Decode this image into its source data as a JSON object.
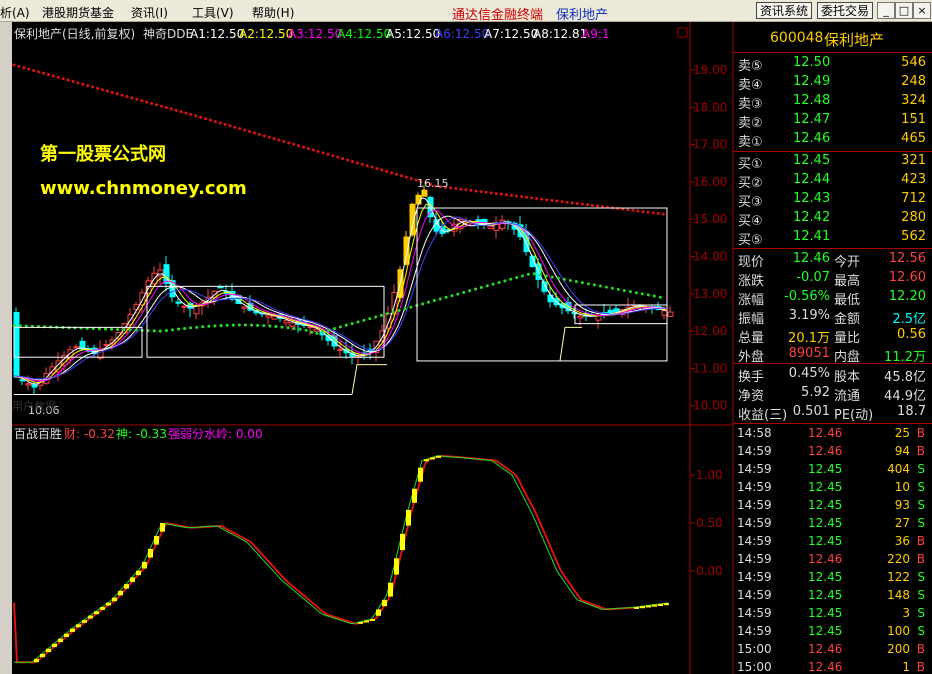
{
  "menubar": {
    "items": [
      "析(A)",
      "港股期货基金",
      "资讯(I)",
      "工具(V)",
      "帮助(H)"
    ],
    "center_title": "通达信金融终端",
    "stock_title": "保利地产",
    "buttons": [
      "资讯系统",
      "委托交易"
    ],
    "window_controls": [
      "_",
      "□",
      "×"
    ]
  },
  "chart_header": {
    "name": "保利地产(日线,前复权)",
    "indicator": "神奇DDE",
    "ma_labels": [
      {
        "label": "A1:",
        "value": "12.50",
        "color": "#ffffff"
      },
      {
        "label": "A2:",
        "value": "12.50",
        "color": "#ffff00"
      },
      {
        "label": "A3:",
        "value": "12.50",
        "color": "#ff00ff"
      },
      {
        "label": "A4:",
        "value": "12.50",
        "color": "#00ff00"
      },
      {
        "label": "A5:",
        "value": "12.50",
        "color": "#ffffff"
      },
      {
        "label": "A6:",
        "value": "12.50",
        "color": "#4040ff"
      },
      {
        "label": "A7:",
        "value": "12.50",
        "color": "#ffffff"
      },
      {
        "label": "A8:",
        "value": "12.81",
        "color": "#ffffff"
      },
      {
        "label": "A9:",
        "value": "1",
        "color": "#ff00ff"
      }
    ]
  },
  "watermark": {
    "line1": "第一股票公式网",
    "line2": "www.chnmoney.com"
  },
  "annotations": {
    "high_label": "16.15",
    "low_label": "10.06",
    "ghost_text": "用户数据"
  },
  "price_axis": [
    "19.00",
    "18.00",
    "17.00",
    "16.00",
    "15.00",
    "14.00",
    "13.00",
    "12.00",
    "11.00",
    "10.00"
  ],
  "sub_chart": {
    "title": "百战百胜",
    "labels": [
      {
        "label": "财:",
        "value": "-0.32",
        "color": "#ff4040"
      },
      {
        "label": "神:",
        "value": "-0.33",
        "color": "#22ff22"
      },
      {
        "label": "强弱分水岭:",
        "value": "0.00",
        "color": "#ff00ff"
      }
    ],
    "axis": [
      "1.00",
      "0.50",
      "0.00"
    ]
  },
  "quote": {
    "code": "600048",
    "name": "保利地产",
    "asks": [
      {
        "label": "卖⑤",
        "price": "12.50",
        "vol": "546"
      },
      {
        "label": "卖④",
        "price": "12.49",
        "vol": "248"
      },
      {
        "label": "卖③",
        "price": "12.48",
        "vol": "324"
      },
      {
        "label": "卖②",
        "price": "12.47",
        "vol": "151"
      },
      {
        "label": "卖①",
        "price": "12.46",
        "vol": "465"
      }
    ],
    "bids": [
      {
        "label": "买①",
        "price": "12.45",
        "vol": "321"
      },
      {
        "label": "买②",
        "price": "12.44",
        "vol": "423"
      },
      {
        "label": "买③",
        "price": "12.43",
        "vol": "712"
      },
      {
        "label": "买④",
        "price": "12.42",
        "vol": "280"
      },
      {
        "label": "买⑤",
        "price": "12.41",
        "vol": "562"
      }
    ],
    "stats": [
      {
        "l1": "现价",
        "v1": "12.46",
        "c1": "#22ff22",
        "l2": "今开",
        "v2": "12.56",
        "c2": "#ff4040"
      },
      {
        "l1": "涨跌",
        "v1": "-0.07",
        "c1": "#22ff22",
        "l2": "最高",
        "v2": "12.60",
        "c2": "#ff4040"
      },
      {
        "l1": "涨幅",
        "v1": "-0.56%",
        "c1": "#22ff22",
        "l2": "最低",
        "v2": "12.20",
        "c2": "#22ff22"
      },
      {
        "l1": "振幅",
        "v1": "3.19%",
        "c1": "#dddddd",
        "l2": "金额",
        "v2": "2.5亿",
        "c2": "#00ffff"
      },
      {
        "l1": "总量",
        "v1": "20.1万",
        "c1": "#ffcc00",
        "l2": "量比",
        "v2": "0.56",
        "c2": "#ffcc00"
      },
      {
        "l1": "外盘",
        "v1": "89051",
        "c1": "#ff4040",
        "l2": "内盘",
        "v2": "11.2万",
        "c2": "#22ff22"
      }
    ],
    "stats2": [
      {
        "l1": "换手",
        "v1": "0.45%",
        "l2": "股本",
        "v2": "45.8亿"
      },
      {
        "l1": "净资",
        "v1": "5.92",
        "l2": "流通",
        "v2": "44.9亿"
      },
      {
        "l1": "收益(三)",
        "v1": "0.501",
        "l2": "PE(动)",
        "v2": "18.7"
      }
    ],
    "ticks": [
      {
        "time": "14:58",
        "price": "12.46",
        "vol": "25",
        "side": "B"
      },
      {
        "time": "14:59",
        "price": "12.46",
        "vol": "94",
        "side": "B"
      },
      {
        "time": "14:59",
        "price": "12.45",
        "vol": "404",
        "side": "S"
      },
      {
        "time": "14:59",
        "price": "12.45",
        "vol": "10",
        "side": "S"
      },
      {
        "time": "14:59",
        "price": "12.45",
        "vol": "93",
        "side": "S"
      },
      {
        "time": "14:59",
        "price": "12.45",
        "vol": "27",
        "side": "S"
      },
      {
        "time": "14:59",
        "price": "12.45",
        "vol": "36",
        "side": "B"
      },
      {
        "time": "14:59",
        "price": "12.46",
        "vol": "220",
        "side": "B"
      },
      {
        "time": "14:59",
        "price": "12.45",
        "vol": "122",
        "side": "S"
      },
      {
        "time": "14:59",
        "price": "12.45",
        "vol": "148",
        "side": "S"
      },
      {
        "time": "14:59",
        "price": "12.45",
        "vol": "3",
        "side": "S"
      },
      {
        "time": "14:59",
        "price": "12.45",
        "vol": "100",
        "side": "S"
      },
      {
        "time": "15:00",
        "price": "12.46",
        "vol": "200",
        "side": "B"
      },
      {
        "time": "15:00",
        "price": "12.46",
        "vol": "1",
        "side": "B"
      }
    ]
  },
  "colors": {
    "up": "#ff4040",
    "down": "#00ffff",
    "ask_bid_price": "#22ff22",
    "volume": "#ffcc00",
    "border": "#a00000"
  }
}
